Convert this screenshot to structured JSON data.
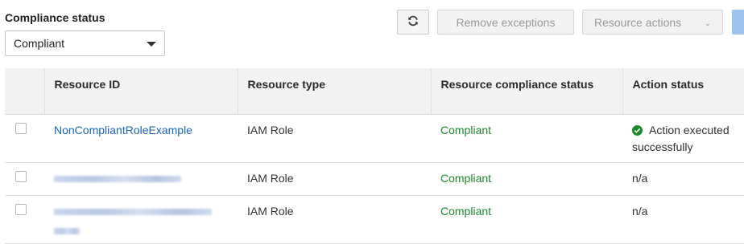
{
  "filter": {
    "label": "Compliance status",
    "selected": "Compliant"
  },
  "toolbar": {
    "refresh_icon": "refresh-icon",
    "remove_label": "Remove exceptions",
    "actions_label": "Resource actions"
  },
  "table": {
    "columns": [
      "Resource ID",
      "Resource type",
      "Resource compliance status",
      "Action status"
    ],
    "rows": [
      {
        "resource_id": "NonCompliantRoleExample",
        "resource_type": "IAM Role",
        "compliance": "Compliant",
        "action_status": "Action executed successfully",
        "action_icon": "check-circle-icon"
      },
      {
        "resource_id": "",
        "resource_type": "IAM Role",
        "compliance": "Compliant",
        "action_status": "n/a"
      },
      {
        "resource_id": "",
        "resource_type": "IAM Role",
        "compliance": "Compliant",
        "action_status": "n/a"
      }
    ]
  },
  "colors": {
    "link": "#1a66c2",
    "compliant": "#1d8a2c",
    "header_bg": "#f2f2f2"
  }
}
